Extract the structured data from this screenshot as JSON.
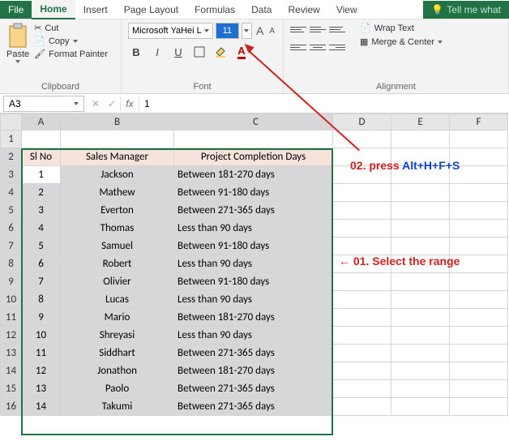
{
  "tabs": {
    "file": "File",
    "home": "Home",
    "insert": "Insert",
    "pageLayout": "Page Layout",
    "formulas": "Formulas",
    "data": "Data",
    "review": "Review",
    "view": "View",
    "tellme": "Tell me what"
  },
  "ribbon": {
    "clipboard": {
      "paste": "Paste",
      "cut": "Cut",
      "copy": "Copy",
      "formatPainter": "Format Painter",
      "label": "Clipboard"
    },
    "font": {
      "name": "Microsoft YaHei L",
      "size": "11",
      "label": "Font"
    },
    "alignment": {
      "wrap": "Wrap Text",
      "merge": "Merge & Center",
      "label": "Alignment"
    }
  },
  "namebox": "A3",
  "formula": "1",
  "columns": [
    "A",
    "B",
    "C",
    "D",
    "E",
    "F"
  ],
  "rowNums": [
    1,
    2,
    3,
    4,
    5,
    6,
    7,
    8,
    9,
    10,
    11,
    12,
    13,
    14,
    15,
    16
  ],
  "header": {
    "a": "Sl No",
    "b": "Sales Manager",
    "c": "Project Completion Days"
  },
  "rows": [
    {
      "n": "1",
      "m": "Jackson",
      "d": "Between 181-270 days"
    },
    {
      "n": "2",
      "m": "Mathew",
      "d": "Between 91-180 days"
    },
    {
      "n": "3",
      "m": "Everton",
      "d": "Between 271-365 days"
    },
    {
      "n": "4",
      "m": "Thomas",
      "d": "Less than 90 days"
    },
    {
      "n": "5",
      "m": "Samuel",
      "d": "Between 91-180 days"
    },
    {
      "n": "6",
      "m": "Robert",
      "d": "Less than 90 days"
    },
    {
      "n": "7",
      "m": "Olivier",
      "d": "Between 91-180 days"
    },
    {
      "n": "8",
      "m": "Lucas",
      "d": "Less than 90 days"
    },
    {
      "n": "9",
      "m": "Mario",
      "d": "Between 181-270 days"
    },
    {
      "n": "10",
      "m": "Shreyasi",
      "d": "Less than 90 days"
    },
    {
      "n": "11",
      "m": "Siddhart",
      "d": "Between 271-365 days"
    },
    {
      "n": "12",
      "m": "Jonathon",
      "d": "Between 181-270 days"
    },
    {
      "n": "13",
      "m": "Paolo",
      "d": "Between 271-365 days"
    },
    {
      "n": "14",
      "m": "Takumi",
      "d": "Between 271-365 days"
    }
  ],
  "anno": {
    "step1": "01. Select the range",
    "step2a": "02. press ",
    "step2b": "Alt+H+F+S",
    "arrow1": "←"
  }
}
